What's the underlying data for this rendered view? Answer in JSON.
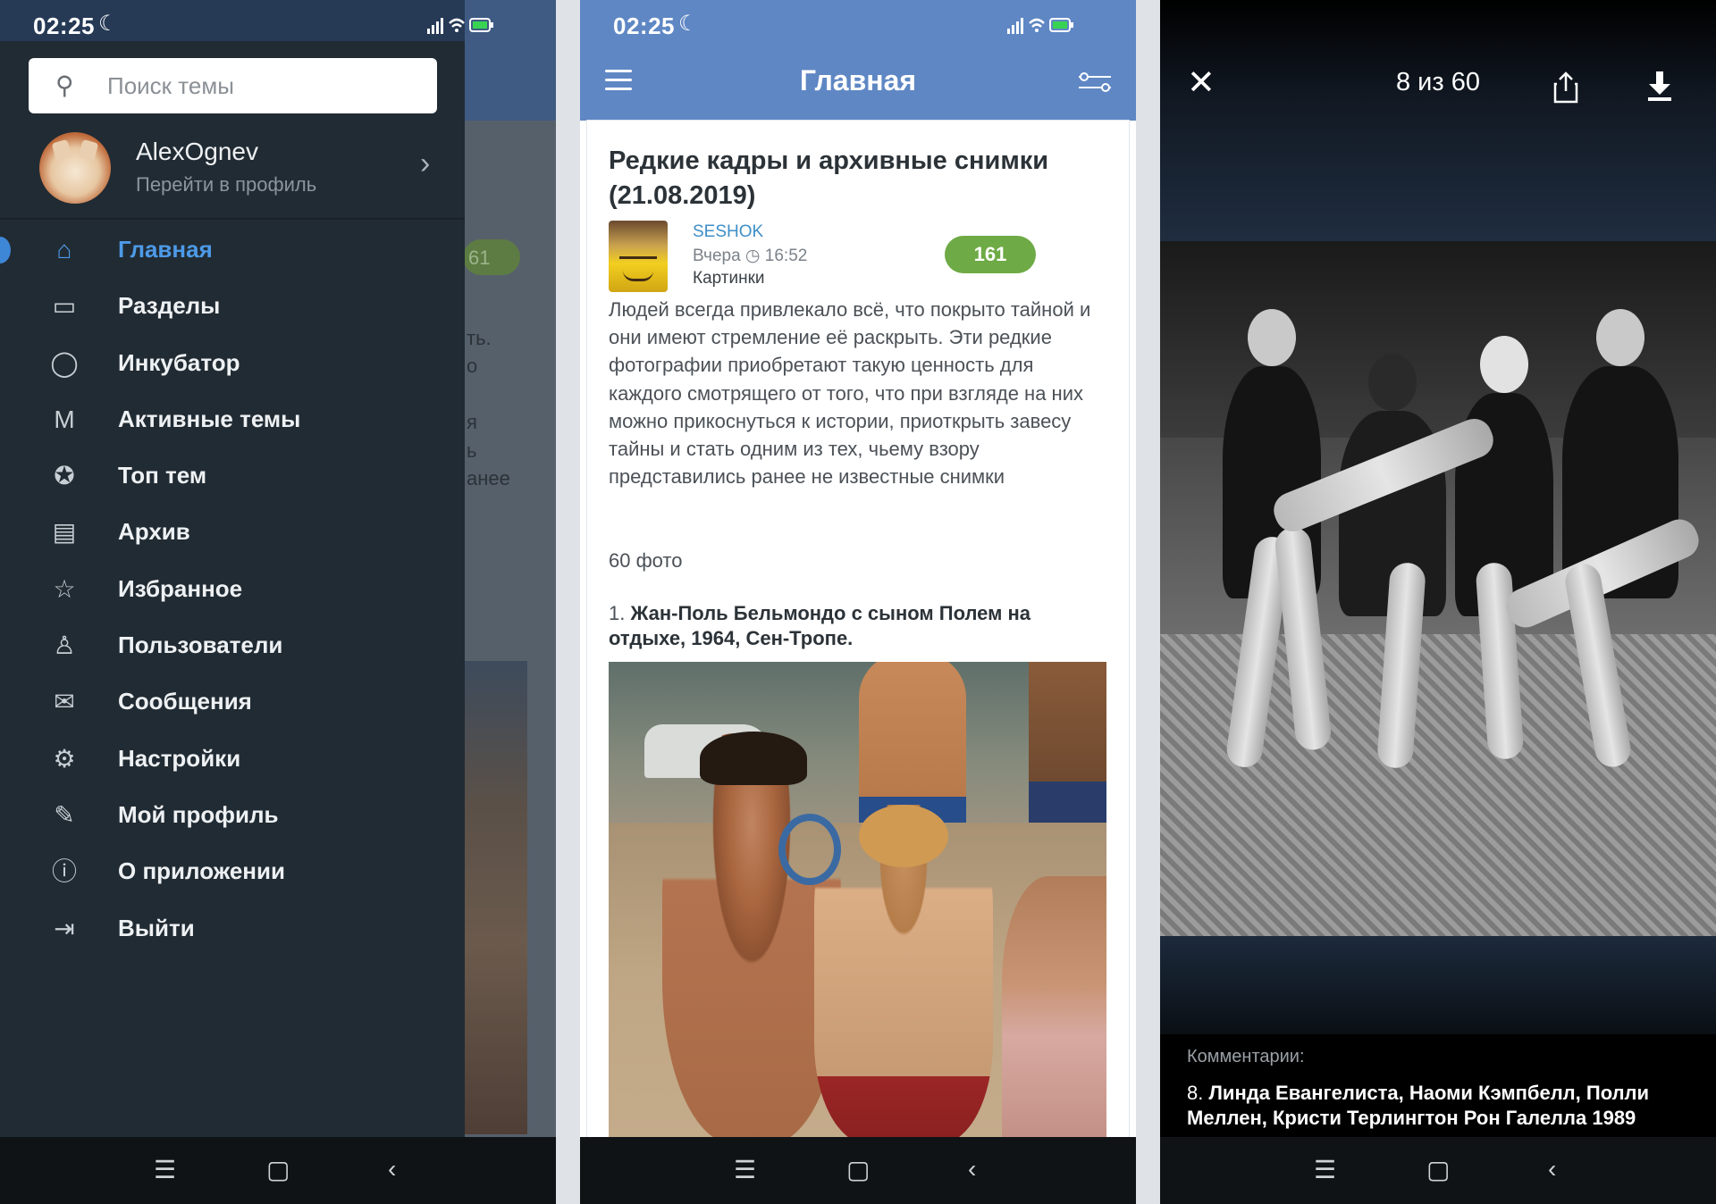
{
  "status_bar": {
    "time": "02:25",
    "moon": "☾"
  },
  "drawer": {
    "search_placeholder": "Поиск темы",
    "profile": {
      "name": "AlexOgnev",
      "subtitle": "Перейти в профиль"
    },
    "menu": [
      {
        "label": "Главная",
        "icon": "home-icon",
        "glyph": "⌂",
        "active": true
      },
      {
        "label": "Разделы",
        "icon": "folder-icon",
        "glyph": "▭"
      },
      {
        "label": "Инкубатор",
        "icon": "egg-icon",
        "glyph": "◯"
      },
      {
        "label": "Активные темы",
        "icon": "activity-icon",
        "glyph": "M"
      },
      {
        "label": "Топ тем",
        "icon": "award-icon",
        "glyph": "✪"
      },
      {
        "label": "Архив",
        "icon": "archive-icon",
        "glyph": "▤"
      },
      {
        "label": "Избранное",
        "icon": "star-icon",
        "glyph": "☆"
      },
      {
        "label": "Пользователи",
        "icon": "user-icon",
        "glyph": "♙"
      },
      {
        "label": "Сообщения",
        "icon": "mail-icon",
        "glyph": "✉"
      },
      {
        "label": "Настройки",
        "icon": "gear-icon",
        "glyph": "⚙"
      },
      {
        "label": "Мой профиль",
        "icon": "pencil-icon",
        "glyph": "✎"
      },
      {
        "label": "О приложении",
        "icon": "info-icon",
        "glyph": "ⓘ"
      },
      {
        "label": "Выйти",
        "icon": "logout-icon",
        "glyph": "⇥"
      }
    ],
    "background": {
      "pill": "61",
      "text_fragments": [
        "ть.",
        "о",
        "я",
        "ь",
        "анее"
      ]
    }
  },
  "article_screen": {
    "header_title": "Главная",
    "article": {
      "title": "Редкие кадры и архивные снимки (21.08.2019)",
      "author": "SESHOK",
      "date": "Вчера ◷ 16:52",
      "category": "Картинки",
      "comments_count": "161",
      "body": "Людей всегда привлекало всё, что покрыто тайной и они имеют стремление её раскрыть. Эти редкие фотографии приобретают такую ценность для каждого смотрящего от того, что при взгляде на них можно прикоснуться к истории, приоткрыть завесу тайны и стать одним из тех, чьему взору представились ранее не известные снимки",
      "photo_count": "60 фото",
      "caption_num": "1.",
      "caption": "Жан-Поль Бельмондо с сыном Полем на отдыхе, 1964, Сен-Тропе."
    }
  },
  "viewer": {
    "counter": "8 из 60",
    "comments_label": "Комментарии:",
    "caption_num": "8.",
    "caption": "Линда Евангелиста, Наоми Кэмпбелл, Полли Меллен, Кристи Терлингтон Рон Галелла 1989"
  },
  "navbar": {
    "menu": "☰",
    "home": "▢",
    "back": "‹"
  },
  "colors": {
    "accent": "#4d9ae8",
    "header": "#5f87c4",
    "pill": "#6eaa45",
    "drawer": "#212b33"
  }
}
